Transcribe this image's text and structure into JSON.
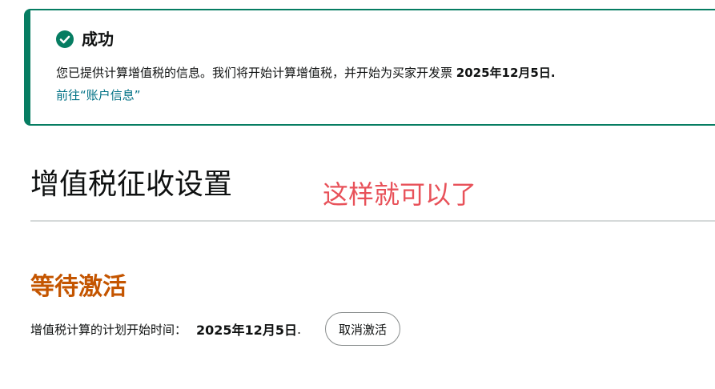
{
  "alert": {
    "title": "成功",
    "message_prefix": "您已提供计算增值税的信息。我们将开始计算增值税，并开始为买家开发票 ",
    "message_date": "2025年12月5日.",
    "link_text": "前往“账户信息”",
    "icon": "check-circle-icon",
    "color": "#067d62"
  },
  "page": {
    "title": "增值税征收设置",
    "annotation": "这样就可以了",
    "annotation_color": "#e8525a"
  },
  "status": {
    "heading": "等待激活",
    "heading_color": "#c45500",
    "schedule_label": "增值税计算的计划开始时间：",
    "schedule_date": "2025年12月5日",
    "schedule_suffix": ".",
    "cancel_button_label": "取消激活"
  }
}
